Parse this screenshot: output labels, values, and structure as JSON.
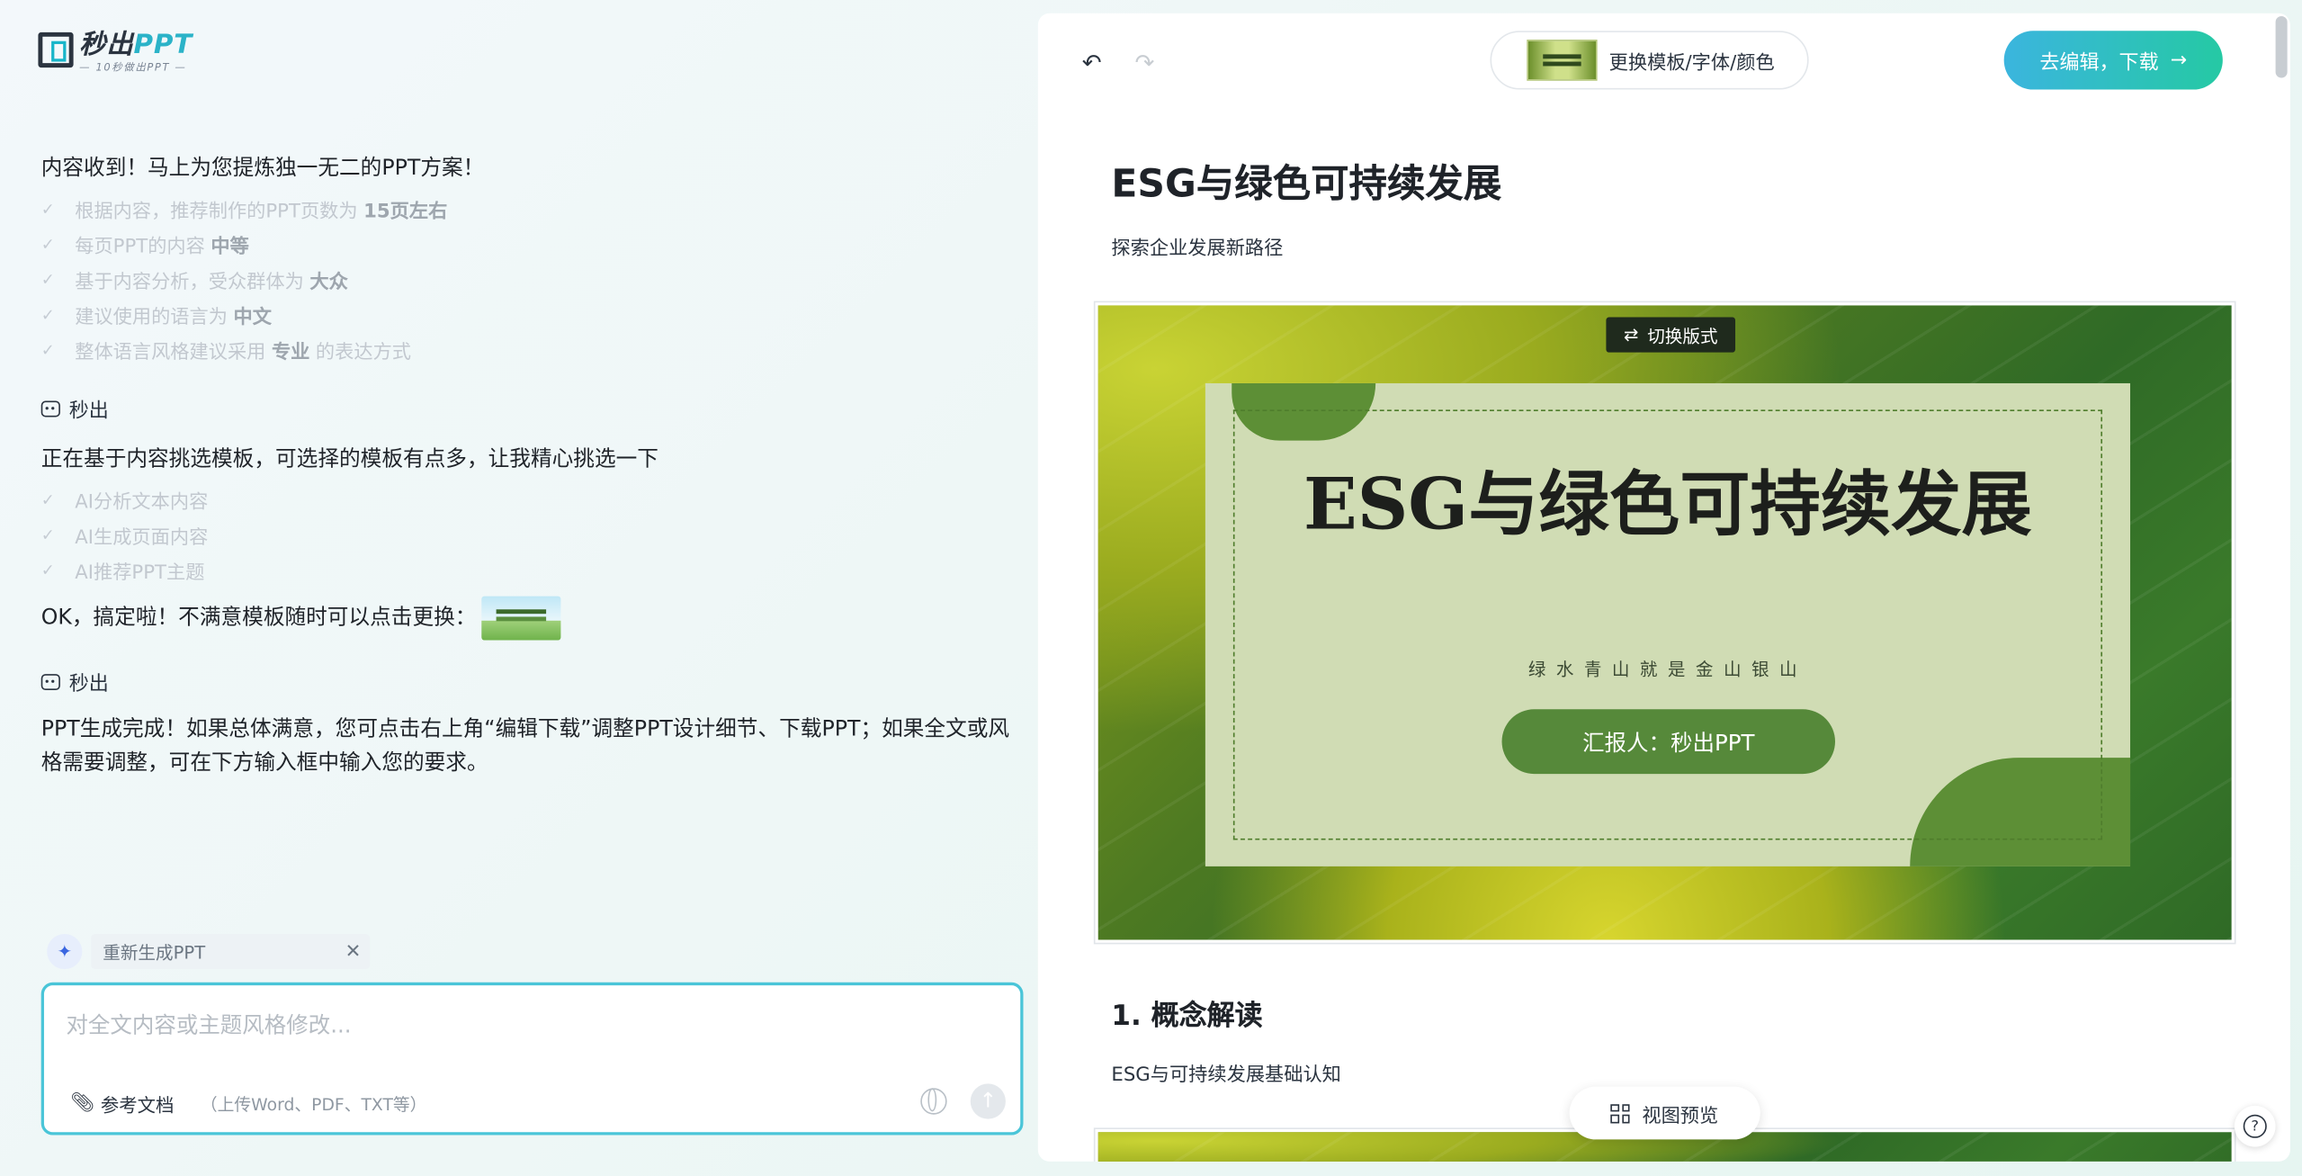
{
  "logo": {
    "main_a": "秒出",
    "main_b": "PPT",
    "sub": "— 10秒做出PPT —"
  },
  "chat": {
    "msg1": "内容收到！马上为您提炼独一无二的PPT方案！",
    "checklist1": [
      {
        "text": "根据内容，推荐制作的PPT页数为",
        "bold": "15页左右"
      },
      {
        "text": "每页PPT的内容",
        "bold": "中等"
      },
      {
        "text": "基于内容分析，受众群体为",
        "bold": "大众"
      },
      {
        "text": "建议使用的语言为",
        "bold": "中文"
      },
      {
        "text": "整体语言风格建议采用",
        "bold": "专业",
        "after": "的表达方式"
      }
    ],
    "sender1": "秒出",
    "msg2": "正在基于内容挑选模板，可选择的模板有点多，让我精心挑选一下",
    "checklist2": [
      "AI分析文本内容",
      "AI生成页面内容",
      "AI推荐PPT主题"
    ],
    "msg3": "OK，搞定啦！不满意模板随时可以点击更换：",
    "sender2": "秒出",
    "msg4": "PPT生成完成！如果总体满意，您可点击右上角“编辑下载”调整PPT设计细节、下载PPT；如果全文或风格需要调整，可在下方输入框中输入您的要求。"
  },
  "chip": {
    "label": "重新生成PPT",
    "close": "✕"
  },
  "input": {
    "placeholder": "对全文内容或主题风格修改...",
    "attach_label": "参考文档",
    "attach_hint": "（上传Word、PDF、TXT等）"
  },
  "toolbar": {
    "undo": "↶",
    "redo": "↷",
    "template_label": "更换模板/字体/颜色",
    "go_label": "去编辑，下载",
    "go_arrow": "→"
  },
  "doc": {
    "title": "ESG与绿色可持续发展",
    "subtitle": "探索企业发展新路径",
    "slide": {
      "switch_label": "切换版式",
      "switch_icon": "⇄",
      "title": "ESG与绿色可持续发展",
      "subtitle": "绿水青山就是金山银山",
      "reporter": "汇报人：秒出PPT"
    },
    "section1_title": "1. 概念解读",
    "section1_sub": "ESG与可持续发展基础认知"
  },
  "view_preview": "视图预览",
  "help_icon": "?",
  "colors": {
    "accent": "#2bc4b4",
    "input_border": "#4ac5d8",
    "slide_green": "#56893a",
    "card_bg": "#d0dcb4"
  }
}
